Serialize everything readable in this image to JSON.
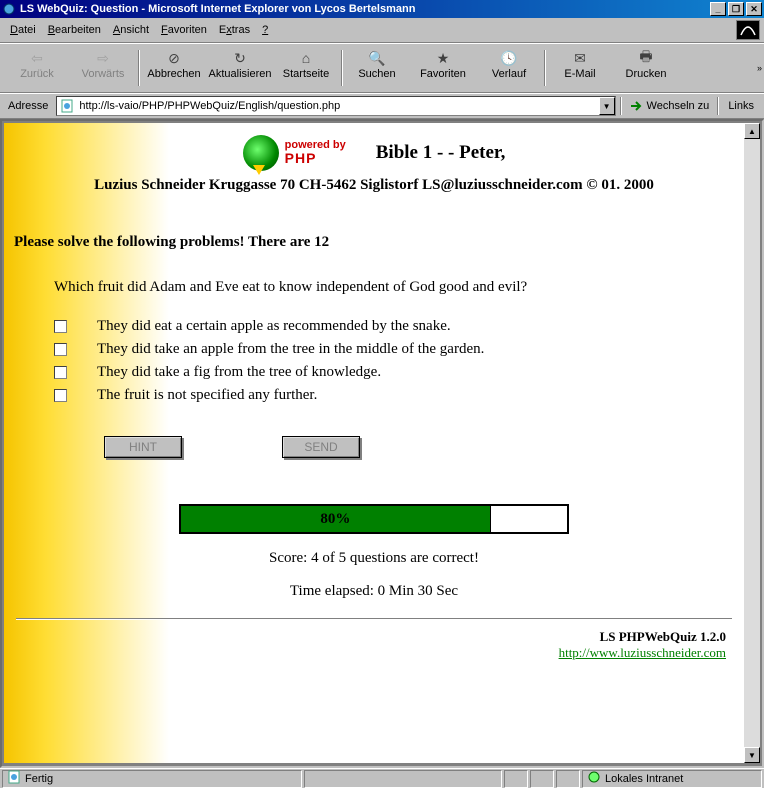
{
  "window": {
    "title": "LS WebQuiz: Question - Microsoft Internet Explorer von Lycos Bertelsmann"
  },
  "menu": {
    "items": [
      "Datei",
      "Bearbeiten",
      "Ansicht",
      "Favoriten",
      "Extras",
      "?"
    ]
  },
  "toolbar": {
    "back": "Zurück",
    "forward": "Vorwärts",
    "stop": "Abbrechen",
    "refresh": "Aktualisieren",
    "home": "Startseite",
    "search": "Suchen",
    "favorites": "Favoriten",
    "history": "Verlauf",
    "mail": "E-Mail",
    "print": "Drucken"
  },
  "address": {
    "label": "Adresse",
    "url": "http://ls-vaio/PHP/PHPWebQuiz/English/question.php",
    "go": "Wechseln zu",
    "links": "Links"
  },
  "page": {
    "powered_by": "powered by",
    "php": "PHP",
    "title": "Bible 1 - - Peter,",
    "byline": "Luzius Schneider Kruggasse 70 CH-5462 Siglistorf LS@luziusschneider.com © 01. 2000",
    "instructions": "Please solve the following problems! There are 12",
    "question": "Which fruit did Adam and Eve eat to know independent of God good and evil?",
    "answers": [
      "They did eat a certain apple as recommended by the snake.",
      "They did take an apple from the tree in the middle of the garden.",
      "They did take a fig from the tree of knowledge.",
      "The fruit is not specified any further."
    ],
    "hint_btn": "HINT",
    "send_btn": "SEND",
    "progress_pct": "80%",
    "progress_pct_num": 80,
    "score_text": "Score: 4 of 5 questions are correct!",
    "elapsed_text": "Time elapsed: 0 Min 30 Sec",
    "footer_version": "LS PHPWebQuiz 1.2.0",
    "footer_url": "http://www.luziusschneider.com"
  },
  "status": {
    "ready": "Fertig",
    "zone": "Lokales Intranet"
  }
}
